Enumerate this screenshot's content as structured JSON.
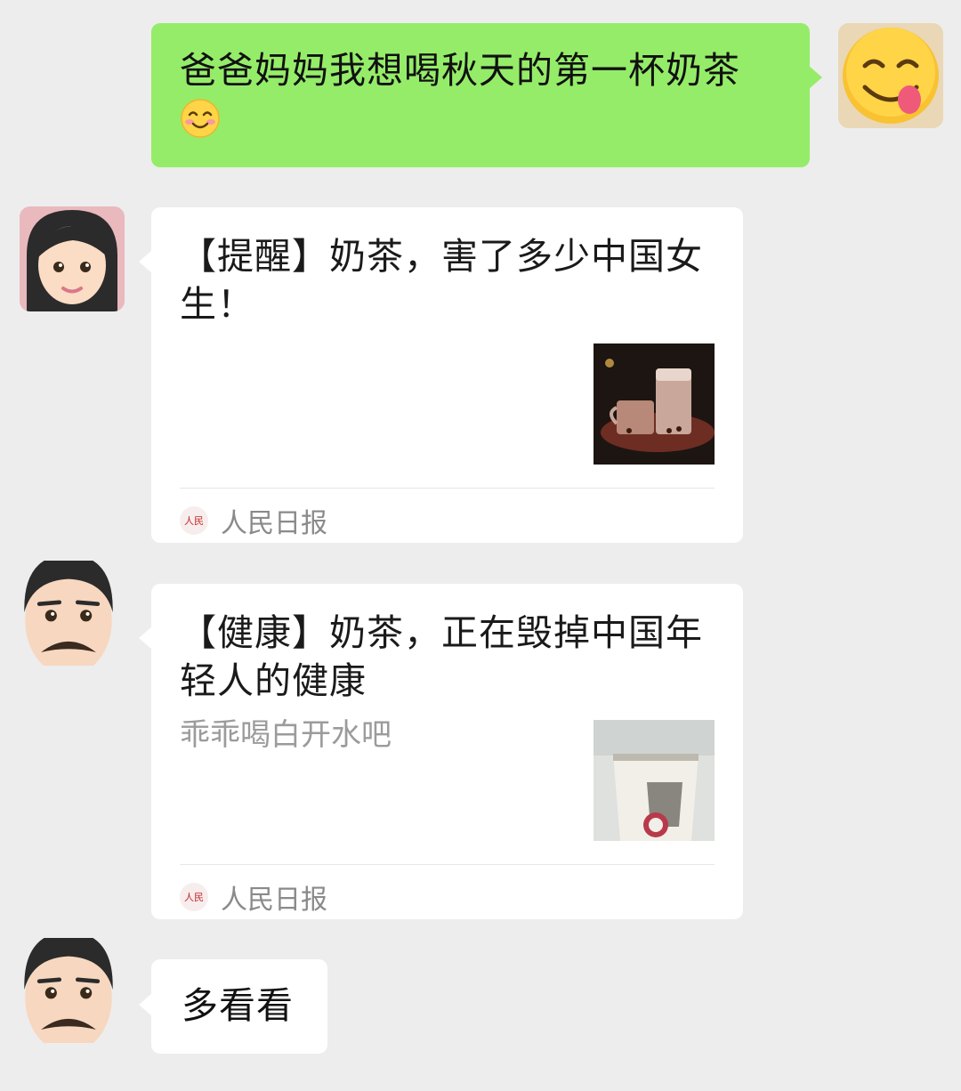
{
  "messages": [
    {
      "side": "right",
      "type": "text",
      "text": "爸爸妈妈我想喝秋天的第一杯奶茶",
      "trailing_emoji": "blush-emoji"
    },
    {
      "side": "left",
      "type": "card",
      "avatar": "woman-emoji",
      "title": "【提醒】奶茶，害了多少中国女生！",
      "description": "",
      "thumbnail": "milk-tea-photo",
      "source": "人民日报"
    },
    {
      "side": "left",
      "type": "card",
      "avatar": "man-mustache-emoji",
      "title": "【健康】奶茶，正在毁掉中国年轻人的健康",
      "description": "乖乖喝白开水吧",
      "thumbnail": "milk-tea-cup-photo",
      "source": "人民日报"
    },
    {
      "side": "left",
      "type": "text",
      "avatar": "man-mustache-emoji",
      "text": "多看看"
    }
  ],
  "colors": {
    "background": "#ededed",
    "sent_bubble": "#95ec69",
    "received_bubble": "#ffffff",
    "secondary_text": "#9b9b9b"
  }
}
